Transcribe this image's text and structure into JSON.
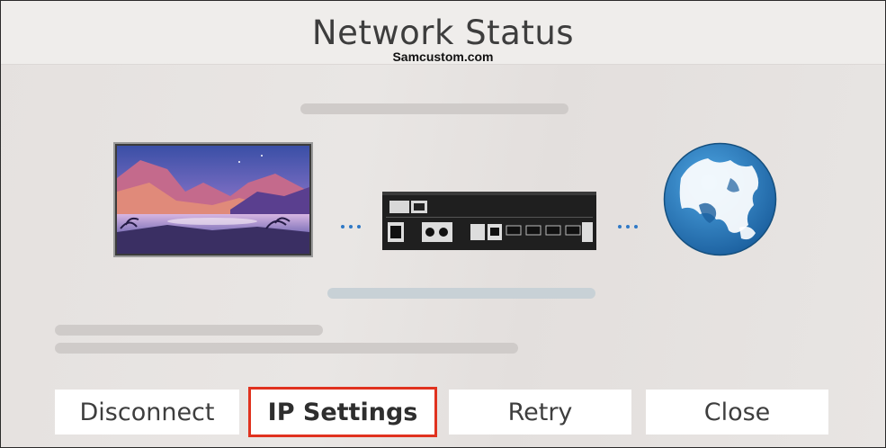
{
  "header": {
    "title": "Network Status",
    "watermark": "Samcustom.com"
  },
  "diagram": {
    "devices": [
      "tv-icon",
      "one-connect-box-icon",
      "globe-icon"
    ],
    "connector_color": "#2f79c6"
  },
  "buttons": [
    {
      "label": "Disconnect",
      "focused": false
    },
    {
      "label": "IP Settings",
      "focused": true
    },
    {
      "label": "Retry",
      "focused": false
    },
    {
      "label": "Close",
      "focused": false
    }
  ],
  "colors": {
    "focus_outline": "#e0321f",
    "background": "#e7e3e1",
    "header_bg": "#efedeb"
  }
}
